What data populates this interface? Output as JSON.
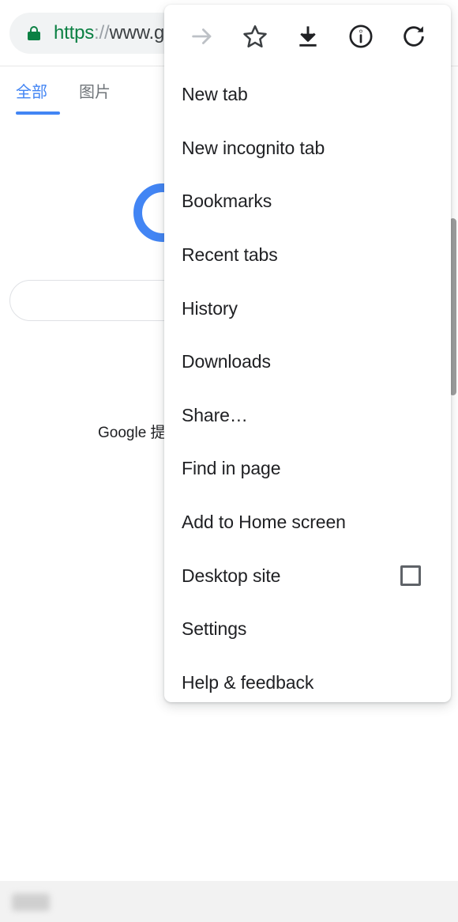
{
  "browser": {
    "omnibox": {
      "lock_icon": "lock-icon",
      "url_scheme": "https",
      "url_separator": "://",
      "url_host": "www.g",
      "full_text": "https://www.g"
    }
  },
  "page": {
    "tabs": [
      {
        "label": "全部",
        "active": true
      },
      {
        "label": "图片",
        "active": false
      }
    ],
    "logo": "google-g-logo",
    "search_placeholder": "",
    "search_value": "",
    "powered_by": "Google 提供",
    "scrollbar": "vertical-scrollbar"
  },
  "menu": {
    "icons": [
      {
        "name": "forward-arrow-icon",
        "label": "Forward",
        "disabled": true
      },
      {
        "name": "star-icon",
        "label": "Bookmark",
        "disabled": false
      },
      {
        "name": "download-icon",
        "label": "Download",
        "disabled": false
      },
      {
        "name": "info-icon",
        "label": "Page info",
        "disabled": false
      },
      {
        "name": "reload-icon",
        "label": "Reload",
        "disabled": false
      }
    ],
    "items": [
      {
        "label": "New tab",
        "checkbox": false
      },
      {
        "label": "New incognito tab",
        "checkbox": false
      },
      {
        "label": "Bookmarks",
        "checkbox": false
      },
      {
        "label": "Recent tabs",
        "checkbox": false
      },
      {
        "label": "History",
        "checkbox": false
      },
      {
        "label": "Downloads",
        "checkbox": false
      },
      {
        "label": "Share…",
        "checkbox": false
      },
      {
        "label": "Find in page",
        "checkbox": false
      },
      {
        "label": "Add to Home screen",
        "checkbox": false
      },
      {
        "label": "Desktop site",
        "checkbox": true,
        "checked": false
      },
      {
        "label": "Settings",
        "checkbox": false
      },
      {
        "label": "Help & feedback",
        "checkbox": false
      }
    ]
  },
  "colors": {
    "accent_blue": "#4285f4",
    "secure_green": "#0b8043",
    "text_primary": "#202124",
    "text_secondary": "#70757a",
    "omnibox_bg": "#f1f3f4",
    "footer_bg": "#f2f2f2"
  }
}
